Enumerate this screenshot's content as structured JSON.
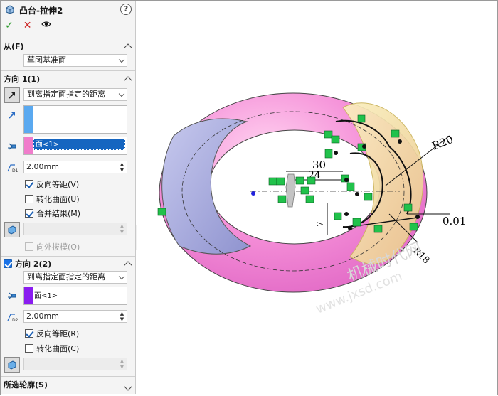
{
  "feature": {
    "title": "凸台-拉伸2",
    "help_icon": "?",
    "ok_icon": "✓",
    "cancel_icon": "✕",
    "preview_icon": "👁"
  },
  "from": {
    "header": "从(F)",
    "condition": "草图基准面"
  },
  "direction1": {
    "header": "方向 1(1)",
    "end_condition": "到离指定面指定的距离",
    "face_item": "面<1>",
    "distance": "2.00mm",
    "reverse_offset_label": "反向等距(V)",
    "reverse_offset_checked": true,
    "translate_surface_label": "转化曲面(U)",
    "translate_surface_checked": false,
    "merge_result_label": "合并结果(M)",
    "merge_result_checked": true,
    "draft_outward_label": "向外拔模(O)",
    "draft_outward_checked": false,
    "face_color": "#f07ccb",
    "direction_color": "#5aa9f0"
  },
  "direction2": {
    "header": "方向 2(2)",
    "enabled": true,
    "end_condition": "到离指定面指定的距离",
    "face_item": "面<1>",
    "distance": "2.00mm",
    "reverse_offset_label": "反向等距(R)",
    "reverse_offset_checked": true,
    "translate_surface_label": "转化曲面(C)",
    "translate_surface_checked": false,
    "face_color": "#8a1cf0"
  },
  "selected_contours": {
    "header": "所选轮廓(S)"
  },
  "viewport": {
    "dimensions": [
      "30",
      "24",
      "R20",
      "0.01",
      "R18",
      "7"
    ],
    "watermark": "机械时代网",
    "watermark_url": "www.jxsd.com"
  }
}
